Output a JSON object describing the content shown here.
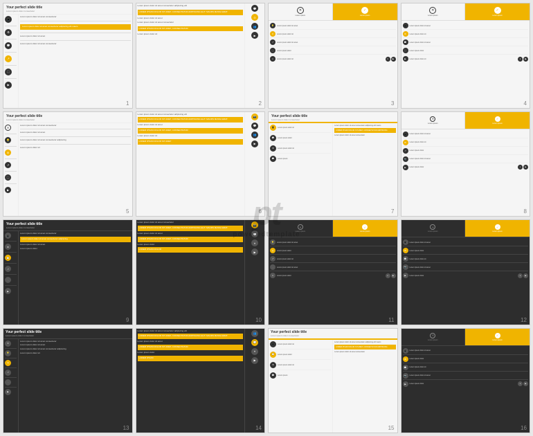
{
  "watermark": {
    "logo": "pt",
    "text": "poweredtemplate"
  },
  "slides": [
    {
      "id": 1,
      "number": "1",
      "theme": "light",
      "title": "Your perfect slide title",
      "subtitle": "Lorem ipsum dolor consectetur"
    },
    {
      "id": 2,
      "number": "2",
      "theme": "light",
      "title": "",
      "subtitle": ""
    },
    {
      "id": 3,
      "number": "3",
      "theme": "light",
      "title": "",
      "subtitle": ""
    },
    {
      "id": 4,
      "number": "4",
      "theme": "light",
      "title": "",
      "subtitle": ""
    },
    {
      "id": 5,
      "number": "5",
      "theme": "light",
      "title": "",
      "subtitle": ""
    },
    {
      "id": 6,
      "number": "6",
      "theme": "light",
      "title": "",
      "subtitle": ""
    },
    {
      "id": 7,
      "number": "7",
      "theme": "light",
      "title": "Your perfect slide title",
      "subtitle": "Lorem ipsum dolor consectetur"
    },
    {
      "id": 8,
      "number": "8",
      "theme": "light",
      "title": "",
      "subtitle": ""
    },
    {
      "id": 9,
      "number": "9",
      "theme": "dark",
      "title": "Your perfect slide title",
      "subtitle": "Lorem ipsum dolor consectetur"
    },
    {
      "id": 10,
      "number": "10",
      "theme": "dark",
      "title": "",
      "subtitle": ""
    },
    {
      "id": 11,
      "number": "11",
      "theme": "dark",
      "title": "",
      "subtitle": ""
    },
    {
      "id": 12,
      "number": "12",
      "theme": "dark",
      "title": "",
      "subtitle": ""
    },
    {
      "id": 13,
      "number": "13",
      "theme": "dark",
      "title": "",
      "subtitle": ""
    },
    {
      "id": 14,
      "number": "14",
      "theme": "dark",
      "title": "",
      "subtitle": ""
    },
    {
      "id": 15,
      "number": "15",
      "theme": "light-yellow",
      "title": "Your perfect slide title",
      "subtitle": "Lorem ipsum dolor consectetur"
    },
    {
      "id": 16,
      "number": "16",
      "theme": "dark",
      "title": "",
      "subtitle": ""
    }
  ],
  "lorem": "Lorem ipsum dolor sit amet, consectetur adipiscing elit. Maurs massa erat.",
  "lorem_short": "Lorem ipsum dolor sit",
  "colors": {
    "yellow": "#f0b400",
    "dark": "#2d2d2d",
    "mid_dark": "#3d3d3d",
    "gray": "#888888",
    "light_bg": "#f5f5f5",
    "white": "#ffffff"
  }
}
